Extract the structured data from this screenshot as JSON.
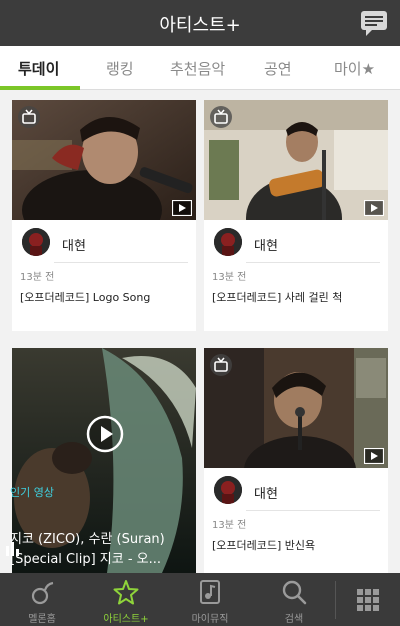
{
  "header": {
    "title": "아티스트+",
    "chat_icon": "chat-icon"
  },
  "tabs": [
    {
      "label": "투데이",
      "active": true
    },
    {
      "label": "랭킹",
      "active": false
    },
    {
      "label": "추천음악",
      "active": false
    },
    {
      "label": "공연",
      "active": false
    },
    {
      "label": "마이★",
      "active": false
    }
  ],
  "colors": {
    "accent": "#7bc628",
    "header_bg": "#3c3c3c",
    "popular_label": "#3fd0e0"
  },
  "cards": [
    {
      "artist": "대현",
      "time": "13분 전",
      "title": "[오프더레코드] Logo Song"
    },
    {
      "artist": "대현",
      "time": "13분 전",
      "title": "[오프더레코드] 사레 걸린 척"
    },
    {
      "artist": "대현",
      "time": "13분 전",
      "title": "[오프더레코드] 반신욕"
    }
  ],
  "popular": {
    "label": "인기 영상",
    "title_line1": "지코 (ZICO), 수란 (Suran)",
    "title_line2": "[Special Clip] 지코 - 오..."
  },
  "bottom_nav": [
    {
      "label": "멜론홈",
      "icon": "melon-home-icon"
    },
    {
      "label": "아티스트+",
      "icon": "star-icon",
      "active": true
    },
    {
      "label": "마이뮤직",
      "icon": "my-music-icon"
    },
    {
      "label": "검색",
      "icon": "search-icon"
    },
    {
      "label": "",
      "icon": "grid-menu-icon"
    }
  ]
}
